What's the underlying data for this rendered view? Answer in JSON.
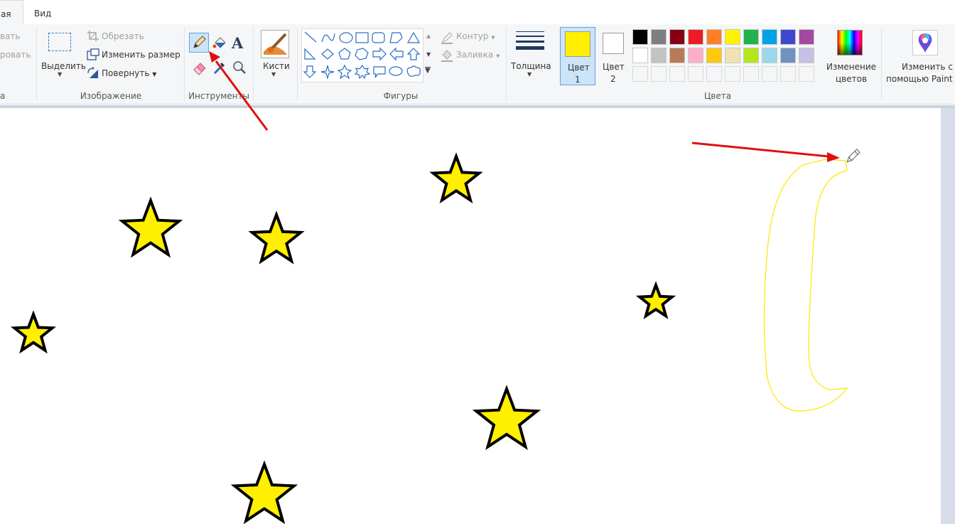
{
  "tabs": {
    "home": "ая",
    "view": "Вид"
  },
  "clipboard": {
    "paste_fragment": "вать",
    "copy_fragment": "ровать",
    "label_fragment": "а"
  },
  "image": {
    "select": "Выделить",
    "crop": "Обрезать",
    "resize": "Изменить размер",
    "rotate": "Повернуть",
    "label": "Изображение"
  },
  "tools": {
    "label": "Инструменты"
  },
  "brushes": {
    "label": "Кисти"
  },
  "shapes": {
    "outline": "Контур",
    "fill": "Заливка",
    "label": "Фигуры"
  },
  "size": {
    "label": "Толщина"
  },
  "color1": {
    "line1": "Цвет",
    "line2": "1",
    "value": "#ffef00"
  },
  "color2": {
    "line1": "Цвет",
    "line2": "2",
    "value": "#ffffff"
  },
  "colors": {
    "label": "Цвета",
    "row1": [
      "#000000",
      "#7f7f7f",
      "#880015",
      "#ed1c24",
      "#ff7f27",
      "#fff200",
      "#22b14c",
      "#00a2e8",
      "#3f48cc",
      "#a349a4"
    ],
    "row2": [
      "#ffffff",
      "#c3c3c3",
      "#b97a57",
      "#ffaec9",
      "#ffc90e",
      "#efe4b0",
      "#b5e61d",
      "#99d9ea",
      "#7092be",
      "#c8bfe7"
    ]
  },
  "edit_colors": {
    "line1": "Изменение",
    "line2": "цветов"
  },
  "paint3d": {
    "line1": "Изменить с",
    "line2": "помощью Paint 3D"
  },
  "canvas": {
    "star_fill": "#ffef00",
    "star_stroke": "#000000",
    "moon_stroke": "#ffe600",
    "arrow_color": "#e01010"
  }
}
